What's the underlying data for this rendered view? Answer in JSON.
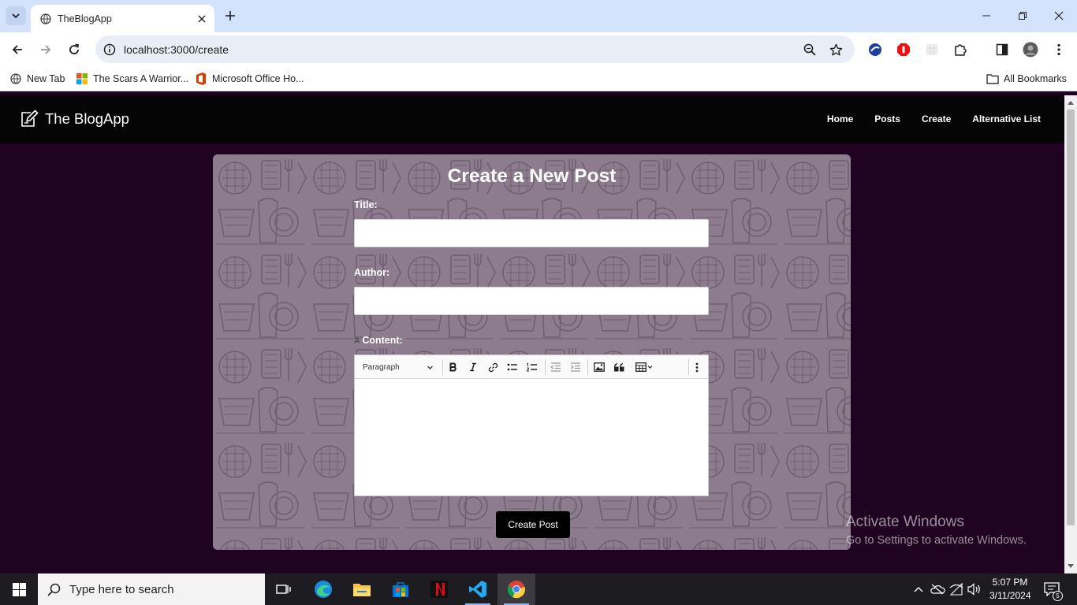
{
  "browser": {
    "tab_title": "TheBlogApp",
    "url": "localhost:3000/create",
    "bookmarks": [
      {
        "label": "New Tab",
        "icon": "globe-icon"
      },
      {
        "label": "The Scars A Warrior...",
        "icon": "windows-logo-icon"
      },
      {
        "label": "Microsoft Office Ho...",
        "icon": "office-icon"
      }
    ],
    "all_bookmarks_label": "All Bookmarks"
  },
  "site": {
    "brand": "The BlogApp",
    "nav": [
      "Home",
      "Posts",
      "Create",
      "Alternative List"
    ]
  },
  "form": {
    "heading": "Create a New Post",
    "title_label": "Title:",
    "author_label": "Author:",
    "content_prefix": "A",
    "content_label": "Content:",
    "editor_format": "Paragraph",
    "submit_label": "Create Post"
  },
  "watermark": {
    "line1": "Activate Windows",
    "line2": "Go to Settings to activate Windows."
  },
  "taskbar": {
    "search_placeholder": "Type here to search",
    "time": "5:07 PM",
    "date": "3/11/2024",
    "notification_count": "5"
  },
  "colors": {
    "page_background": "#1f0320",
    "navbar": "#050505",
    "card": "#8c7c8e",
    "tabstrip": "#d3e3fd"
  }
}
